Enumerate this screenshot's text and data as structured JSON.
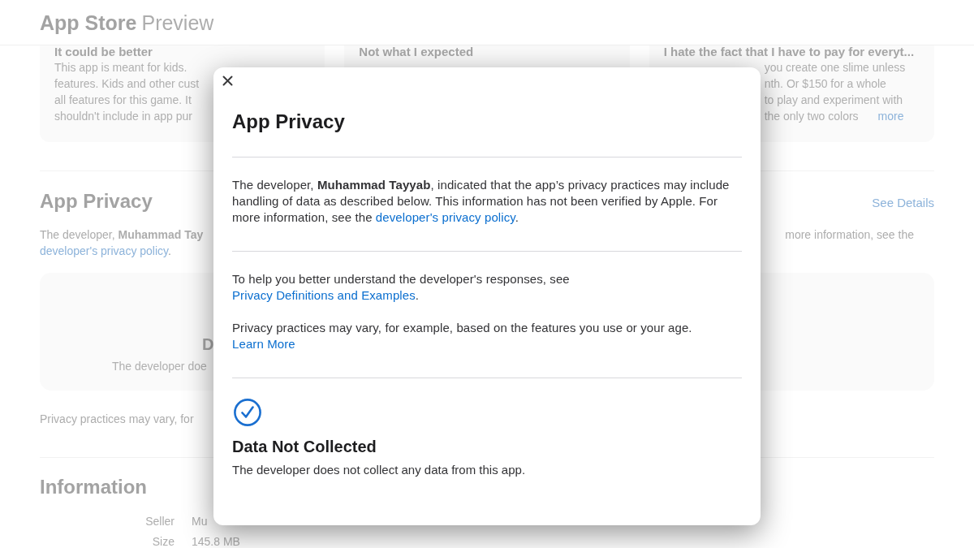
{
  "header": {
    "title": "App Store",
    "subtitle": "Preview"
  },
  "reviews": [
    {
      "title": "It could be better",
      "lines": [
        "This app is meant for kids.",
        "features. Kids and other cust",
        "all features for this game. It",
        "shouldn't include in app pur"
      ]
    },
    {
      "title": "Not what I expected"
    },
    {
      "title": "I hate the fact that I have to pay for everyt...",
      "lines": [
        "you create one slime unless",
        "nth. Or $150 for a whole",
        "to play and experiment with",
        "the only two colors"
      ],
      "more_link": "more"
    }
  ],
  "privacy": {
    "title": "App Privacy",
    "see_details": "See Details",
    "text": "The developer, **Muhammad Tay**",
    "text_right": "more information, see the",
    "policy_link": "developer's privacy policy",
    "policy_after": ".",
    "card": {
      "title": "D",
      "text": "The developer doe"
    },
    "note": "Privacy practices may vary, for"
  },
  "information": {
    "title": "Information",
    "rows": [
      {
        "label": "Seller",
        "value": "Mu"
      },
      {
        "label": "Size",
        "value": "145.8 MB"
      }
    ]
  },
  "modal": {
    "title": "App Privacy",
    "intro": {
      "text": "The developer, **Muhammad Tayyab**, indicated that the app’s privacy practices may include handling of data as described below. This information has not been verified by Apple. For more information, see the",
      "link": "developer's privacy policy",
      "after": "."
    },
    "notes": [
      {
        "text": "To help you better understand the developer's responses, see",
        "link": "Privacy Definitions and Examples",
        "after": "."
      },
      {
        "text": "Privacy practices may vary, for example, based on the features you use or your age.",
        "link": "Learn More"
      }
    ],
    "result": {
      "title": "Data Not Collected",
      "text": "The developer does not collect any data from this app."
    }
  }
}
